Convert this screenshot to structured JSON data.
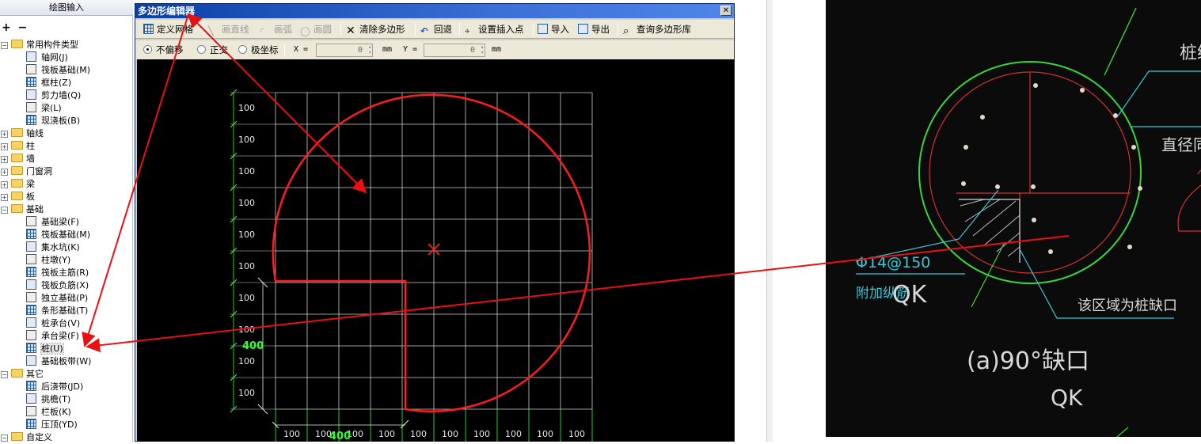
{
  "left_panel": {
    "tab_label": "绘图输入",
    "tree": [
      {
        "label": "常用构件类型",
        "level": 0,
        "type": "folder",
        "expanded": true
      },
      {
        "label": "轴网(J)",
        "level": 1,
        "type": "item",
        "icon": "grid-icon"
      },
      {
        "label": "筏板基础(M)",
        "level": 1,
        "type": "item",
        "icon": "raft-foundation-icon"
      },
      {
        "label": "框柱(Z)",
        "level": 1,
        "type": "item",
        "icon": "column-icon"
      },
      {
        "label": "剪力墙(Q)",
        "level": 1,
        "type": "item",
        "icon": "shear-wall-icon"
      },
      {
        "label": "梁(L)",
        "level": 1,
        "type": "item",
        "icon": "beam-icon"
      },
      {
        "label": "现浇板(B)",
        "level": 1,
        "type": "item",
        "icon": "slab-icon"
      },
      {
        "label": "轴线",
        "level": 0,
        "type": "folder",
        "expanded": false
      },
      {
        "label": "柱",
        "level": 0,
        "type": "folder",
        "expanded": false
      },
      {
        "label": "墙",
        "level": 0,
        "type": "folder",
        "expanded": false
      },
      {
        "label": "门窗洞",
        "level": 0,
        "type": "folder",
        "expanded": false
      },
      {
        "label": "梁",
        "level": 0,
        "type": "folder",
        "expanded": false
      },
      {
        "label": "板",
        "level": 0,
        "type": "folder",
        "expanded": false
      },
      {
        "label": "基础",
        "level": 0,
        "type": "folder",
        "expanded": true
      },
      {
        "label": "基础梁(F)",
        "level": 1,
        "type": "item",
        "icon": "foundation-beam-icon"
      },
      {
        "label": "筏板基础(M)",
        "level": 1,
        "type": "item",
        "icon": "raft-foundation-icon"
      },
      {
        "label": "集水坑(K)",
        "level": 1,
        "type": "item",
        "icon": "sump-icon"
      },
      {
        "label": "柱墩(Y)",
        "level": 1,
        "type": "item",
        "icon": "column-pier-icon"
      },
      {
        "label": "筏板主筋(R)",
        "level": 1,
        "type": "item",
        "icon": "raft-main-rebar-icon"
      },
      {
        "label": "筏板负筋(X)",
        "level": 1,
        "type": "item",
        "icon": "raft-negative-rebar-icon"
      },
      {
        "label": "独立基础(P)",
        "level": 1,
        "type": "item",
        "icon": "isolated-footing-icon"
      },
      {
        "label": "条形基础(T)",
        "level": 1,
        "type": "item",
        "icon": "strip-footing-icon"
      },
      {
        "label": "桩承台(V)",
        "level": 1,
        "type": "item",
        "icon": "pile-cap-icon"
      },
      {
        "label": "承台梁(F)",
        "level": 1,
        "type": "item",
        "icon": "cap-beam-icon"
      },
      {
        "label": "桩(U)",
        "level": 1,
        "type": "item",
        "icon": "pile-icon",
        "selected": true
      },
      {
        "label": "基础板带(W)",
        "level": 1,
        "type": "item",
        "icon": "foundation-strip-icon"
      },
      {
        "label": "其它",
        "level": 0,
        "type": "folder",
        "expanded": true
      },
      {
        "label": "后浇带(JD)",
        "level": 1,
        "type": "item",
        "icon": "post-pour-strip-icon"
      },
      {
        "label": "挑檐(T)",
        "level": 1,
        "type": "item",
        "icon": "cornice-icon"
      },
      {
        "label": "栏板(K)",
        "level": 1,
        "type": "item",
        "icon": "parapet-icon"
      },
      {
        "label": "压顶(YD)",
        "level": 1,
        "type": "item",
        "icon": "coping-icon"
      },
      {
        "label": "自定义",
        "level": 0,
        "type": "folder",
        "expanded": true
      }
    ]
  },
  "dialog": {
    "title": "多边形编辑器",
    "close_icon": "close-icon",
    "toolbar": {
      "define_grid": "定义网格",
      "draw_line": "画直线",
      "draw_arc": "画弧",
      "draw_circle": "画圆",
      "clear_polygon": "清除多边形",
      "undo": "回退",
      "set_insert_point": "设置插入点",
      "import": "导入",
      "export": "导出",
      "query_library": "查询多边形库"
    },
    "options": {
      "no_offset": "不偏移",
      "orthogonal": "正交",
      "polar": "极坐标",
      "x_label": "X =",
      "x_value": "0",
      "y_label": "Y =",
      "y_value": "0",
      "unit": "mm",
      "selected_mode": "不偏移"
    },
    "canvas": {
      "grid_label": "100",
      "row_labels": [
        "100",
        "100",
        "100",
        "100",
        "100",
        "100",
        "100",
        "100",
        "100",
        "100"
      ],
      "col_labels": [
        "100",
        "100",
        "100",
        "100",
        "100",
        "100",
        "100",
        "100",
        "100",
        "100"
      ],
      "dim_vertical": "400",
      "dim_horizontal": "400",
      "colors": {
        "background": "#000000",
        "grid": "#cfcfcf",
        "shape": "#ff1c1c",
        "dimension": "#33ff33"
      }
    }
  },
  "photo": {
    "texts": {
      "top_right": "桩纵",
      "diameter": "直径同",
      "rebar": "Φ14@150",
      "additional": "附加纵筋",
      "qk1": "QK",
      "region_note": "该区域为桩缺口",
      "caption": "(a)90°缺口",
      "qk2": "QK"
    }
  }
}
